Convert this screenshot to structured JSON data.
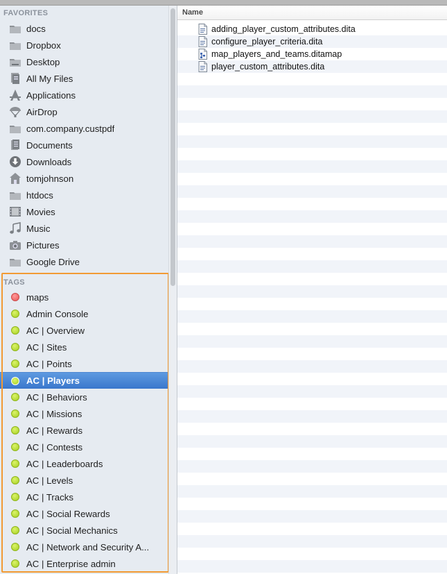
{
  "sidebar": {
    "favorites_header": "FAVORITES",
    "favorites": [
      {
        "label": "docs",
        "icon": "folder-icon"
      },
      {
        "label": "Dropbox",
        "icon": "folder-icon"
      },
      {
        "label": "Desktop",
        "icon": "desktop-icon"
      },
      {
        "label": "All My Files",
        "icon": "all-files-icon"
      },
      {
        "label": "Applications",
        "icon": "applications-icon"
      },
      {
        "label": "AirDrop",
        "icon": "airdrop-icon"
      },
      {
        "label": "com.company.custpdf",
        "icon": "folder-icon"
      },
      {
        "label": "Documents",
        "icon": "documents-icon"
      },
      {
        "label": "Downloads",
        "icon": "downloads-icon"
      },
      {
        "label": "tomjohnson",
        "icon": "home-icon"
      },
      {
        "label": "htdocs",
        "icon": "folder-icon"
      },
      {
        "label": "Movies",
        "icon": "movies-icon"
      },
      {
        "label": "Music",
        "icon": "music-icon"
      },
      {
        "label": "Pictures",
        "icon": "camera-icon"
      },
      {
        "label": "Google Drive",
        "icon": "folder-icon"
      }
    ],
    "tags_header": "TAGS",
    "tags": [
      {
        "label": "maps",
        "color": "red"
      },
      {
        "label": "Admin Console",
        "color": "green"
      },
      {
        "label": "AC | Overview",
        "color": "green"
      },
      {
        "label": "AC | Sites",
        "color": "green"
      },
      {
        "label": "AC | Points",
        "color": "green"
      },
      {
        "label": "AC | Players",
        "color": "green",
        "selected": true
      },
      {
        "label": "AC | Behaviors",
        "color": "green"
      },
      {
        "label": "AC | Missions",
        "color": "green"
      },
      {
        "label": "AC | Rewards",
        "color": "green"
      },
      {
        "label": "AC | Contests",
        "color": "green"
      },
      {
        "label": "AC | Leaderboards",
        "color": "green"
      },
      {
        "label": "AC | Levels",
        "color": "green"
      },
      {
        "label": "AC | Tracks",
        "color": "green"
      },
      {
        "label": "AC | Social Rewards",
        "color": "green"
      },
      {
        "label": "AC | Social Mechanics",
        "color": "green"
      },
      {
        "label": "AC | Network and Security A...",
        "color": "green"
      },
      {
        "label": "AC | Enterprise admin",
        "color": "green"
      }
    ]
  },
  "colors": {
    "selection": "#3a77cc",
    "tag_green": "#a4cf1f",
    "tag_red": "#e85454",
    "highlight_border": "#f29a34"
  },
  "file_list": {
    "column_header": "Name",
    "files": [
      {
        "name": "adding_player_custom_attributes.dita",
        "icon": "dita-file-icon"
      },
      {
        "name": "configure_player_criteria.dita",
        "icon": "dita-file-icon"
      },
      {
        "name": "map_players_and_teams.ditamap",
        "icon": "ditamap-file-icon"
      },
      {
        "name": "player_custom_attributes.dita",
        "icon": "dita-file-icon"
      }
    ]
  }
}
